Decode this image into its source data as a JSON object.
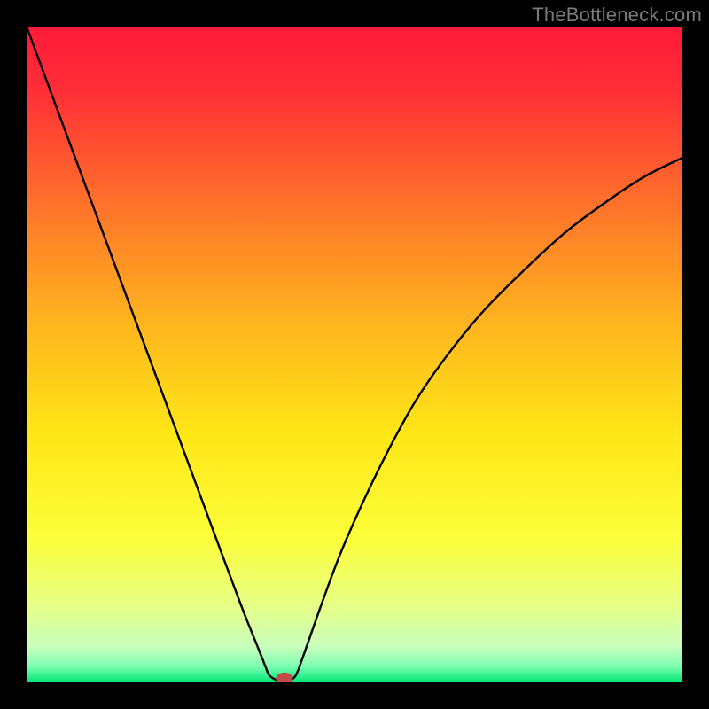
{
  "watermark": "TheBottleneck.com",
  "chart_data": {
    "type": "line",
    "title": "",
    "xlabel": "",
    "ylabel": "",
    "xlim": [
      0,
      100
    ],
    "ylim": [
      0,
      100
    ],
    "background_gradient": {
      "stops": [
        {
          "offset": 0.0,
          "color": "#ff1a39"
        },
        {
          "offset": 0.1,
          "color": "#ff2f37"
        },
        {
          "offset": 0.25,
          "color": "#ff6a2c"
        },
        {
          "offset": 0.45,
          "color": "#ffb41f"
        },
        {
          "offset": 0.62,
          "color": "#ffe617"
        },
        {
          "offset": 0.78,
          "color": "#fbff3a"
        },
        {
          "offset": 0.88,
          "color": "#e8ff84"
        },
        {
          "offset": 0.945,
          "color": "#c9ffbc"
        },
        {
          "offset": 0.975,
          "color": "#7fffb2"
        },
        {
          "offset": 1.0,
          "color": "#00e676"
        }
      ]
    },
    "series": [
      {
        "name": "bottleneck-curve",
        "color": "#000000",
        "x": [
          0,
          5,
          10,
          15,
          20,
          25,
          30,
          33,
          35,
          36,
          36.5,
          37,
          38,
          39,
          39.3,
          40,
          41,
          42,
          45,
          48,
          52,
          56,
          60,
          65,
          70,
          76,
          82,
          88,
          94,
          100
        ],
        "y": [
          100,
          86.5,
          73,
          59.5,
          46,
          32.5,
          19,
          11,
          6,
          3.5,
          2.2,
          1.1,
          0.4,
          0.2,
          0.15,
          0.3,
          1,
          3.5,
          12,
          20,
          29,
          37,
          44,
          51,
          57,
          63,
          68.5,
          73,
          77,
          80
        ]
      }
    ],
    "marker": {
      "name": "optimal-point",
      "x": 39.3,
      "y": 0.6,
      "rx_pct": 1.3,
      "ry_pct": 0.9,
      "fill": "#c54a4a"
    }
  }
}
